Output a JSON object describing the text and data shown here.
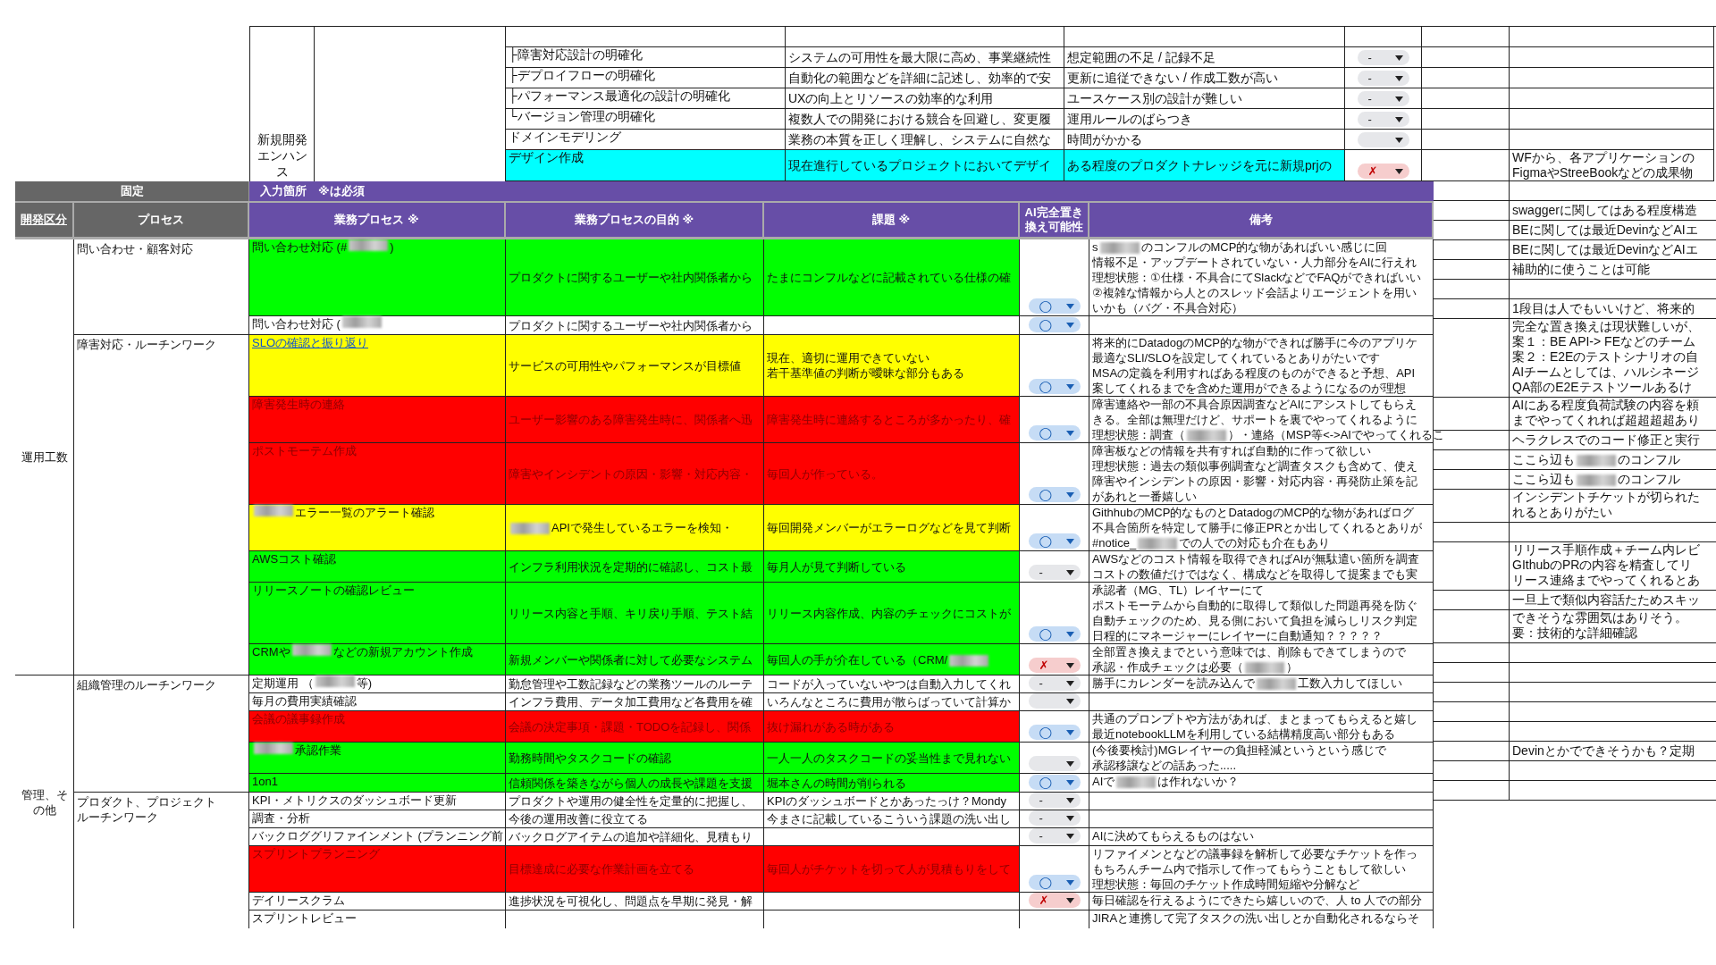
{
  "upper_section": {
    "category": "新規開発エンハンス",
    "rows": [
      {
        "process": "├障害対応設計の明確化",
        "purpose": "システムの可用性を最大限に高め、事業継続性",
        "issue": [
          "想定範囲の不足 / 記録不足"
        ],
        "ai": {
          "kind": "dash",
          "label": "-"
        },
        "color": "#ffffff"
      },
      {
        "process": "├デプロイフローの明確化",
        "purpose": "自動化の範囲などを詳細に記述し、効率的で安",
        "issue": [
          "更新に追従できない / 作成工数が高い"
        ],
        "ai": {
          "kind": "dash",
          "label": "-"
        },
        "color": "#ffffff"
      },
      {
        "process": "├パフォーマンス最適化の設計の明確化",
        "purpose": "UXの向上とリソースの効率的な利用",
        "issue": [
          "ユースケース別の設計が難しい"
        ],
        "ai": {
          "kind": "dash",
          "label": "-"
        },
        "color": "#ffffff"
      },
      {
        "process": "└バージョン管理の明確化",
        "purpose": "複数人での開発における競合を回避し、変更履",
        "issue": [
          "運用ルールのばらつき"
        ],
        "ai": {
          "kind": "dash",
          "label": "-"
        },
        "color": "#ffffff"
      },
      {
        "process": "ドメインモデリング",
        "purpose": "業務の本質を正しく理解し、システムに自然な",
        "issue": [
          "時間がかかる"
        ],
        "ai": {
          "kind": "empty"
        },
        "color": "#ffffff"
      },
      {
        "process": "デザイン作成",
        "purpose": "現在進行しているプロジェクトにおいてデザイ",
        "issue": [
          "ある程度のプロダクトナレッジを元に新規prjの"
        ],
        "ai": {
          "kind": "no",
          "label": "✗"
        },
        "color": "#00ffff",
        "note": [
          "WFから、各アプリケーションの",
          "FigmaやStreeBookなどの成果物"
        ]
      }
    ]
  },
  "header": {
    "fixed_label": "固定",
    "input_label": "入力箇所　※は必須",
    "columns": [
      "開発区分",
      "プロセス",
      "業務プロセス ※",
      "業務プロセスの目的 ※",
      "課題 ※",
      "AI完全置き換え可能性",
      "備考"
    ]
  },
  "sections": [
    {
      "label": "運用工数",
      "groups": [
        {
          "label": "問い合わせ・顧客対応",
          "rows": [
            {
              "process": [
                "問い合わせ対応 (#",
                {
                  "kind": "redaction"
                },
                ")"
              ],
              "link": false,
              "purpose": "プロダクトに関するユーザーや社内関係者から",
              "issue": [
                "たまにコンフルなどに記載されている仕様の確"
              ],
              "ai": {
                "kind": "yes",
                "label": "◯"
              },
              "color": "#00ff00",
              "note": [
                [
                  "s",
                  {
                    "kind": "redaction"
                  },
                  "のコンフルのMCP的な物があればいい感じに回"
                ],
                "情報不足・アップデートされていない・人力部分をAIに行えれ",
                "理想状態：①仕様・不具合にてSlackなどでFAQができればいい",
                "②複雑な情報から人とのスレッド会話よりエージェントを用い",
                "いかも（バグ・不具合対応）"
              ]
            },
            {
              "process": [
                "問い合わせ対応 (",
                {
                  "kind": "redaction"
                }
              ],
              "link": false,
              "purpose": "プロダクトに関するユーザーや社内関係者から",
              "ai": {
                "kind": "yes",
                "label": "◯"
              },
              "color": "#ffffff"
            }
          ]
        },
        {
          "label": "障害対応・ルーチンワーク",
          "rows": [
            {
              "process": "SLOの確認と振り返り",
              "link": true,
              "purpose": "サービスの可用性やパフォーマンスが目標値",
              "issue": [
                "現在、適切に運用できていない",
                "若干基準値の判断が曖昧な部分もある"
              ],
              "ai": {
                "kind": "yes",
                "label": "◯"
              },
              "color": "#ffff00",
              "note": [
                "将来的にDatadogのMCP的な物ができれば勝手に今のアプリケ",
                "最適なSLI/SLOを設定してくれているとありがたいです",
                "MSAの定義を利用すればある程度のものができると予想、API",
                "案してくれるまでを含めた運用ができるようになるのが理想"
              ]
            },
            {
              "process": "障害発生時の連絡",
              "link": false,
              "purpose": "ユーザー影響のある障害発生時に、関係者へ迅",
              "issue": [
                "障害発生時に連絡するところが多かったり、確"
              ],
              "ai": {
                "kind": "yes",
                "label": "◯"
              },
              "color": "#ff0000",
              "note": [
                "障害連絡や一部の不具合原因調査などAIにアシストしてもらえ",
                "きる。全部は無理だけど、サポートを裏でやってくれるように",
                [
                  "理想状態：調査（",
                  {
                    "kind": "redaction"
                  },
                  "）・連絡（MSP等<->AIでやってくれるこ"
                ]
              ]
            },
            {
              "process": "ポストモーテム作成",
              "link": false,
              "purpose": "障害やインシデントの原因・影響・対応内容・",
              "issue": [
                "毎回人が作っている。"
              ],
              "ai": {
                "kind": "yes",
                "label": "◯"
              },
              "color": "#ff0000",
              "note": [
                "障害板などの情報を共有すれば自動的に作って欲しい",
                "理想状態：過去の類似事例調査など調査タスクも含めて、使え",
                "障害やインシデントの原因・影響・対応内容・再発防止策を記",
                "があれと一番嬉しい"
              ]
            },
            {
              "process": [
                {
                  "kind": "redaction"
                },
                "エラー一覧のアラート確認"
              ],
              "link": false,
              "purpose": [
                {
                  "kind": "redaction"
                },
                "APIで発生しているエラーを検知・"
              ],
              "issue": [
                "毎回開発メンバーがエラーログなどを見て判断"
              ],
              "ai": {
                "kind": "yes",
                "label": "◯"
              },
              "color": "#ffff00",
              "note": [
                "GithhubのMCP的なものとDatadogのMCP的な物があればログ",
                "不具合箇所を特定して勝手に修正PRとか出してくれるとありが",
                [
                  "#notice_",
                  {
                    "kind": "redaction"
                  },
                  "での人での対応も介在もあり"
                ]
              ]
            },
            {
              "process": "AWSコスト確認",
              "link": false,
              "purpose": "インフラ利用状況を定期的に確認し、コスト最",
              "issue": [
                "毎月人が見て判断している"
              ],
              "ai": {
                "kind": "dash",
                "label": "-"
              },
              "color": "#00ff00",
              "note": [
                "AWSなどのコスト情報を取得できればAIが無駄遣い箇所を調査",
                "コストの数値だけではなく、構成などを取得して提案までも実"
              ]
            },
            {
              "process": "リリースノートの確認レビュー",
              "link": false,
              "purpose": "リリース内容と手順、キリ戻り手順、テスト結",
              "issue": [
                "リリース内容作成、内容のチェックにコストが"
              ],
              "ai": {
                "kind": "yes",
                "label": "◯"
              },
              "color": "#00ff00",
              "note": [
                "承認者（MG、TL）レイヤーにて",
                "ポストモーテムから自動的に取得して類似した問題再発を防ぐ",
                "自動チェックのため、見る側において負担を減らしリスク判定",
                "日程的にマネージャーにレイヤーに自動通知？？？？？"
              ]
            },
            {
              "process": [
                "CRMや",
                {
                  "kind": "redaction"
                },
                "などの新規アカウント作成"
              ],
              "link": false,
              "purpose": "新規メンバーや関係者に対して必要なシステム",
              "issue": [
                [
                  "毎回人の手が介在している（CRM/",
                  {
                    "kind": "redaction"
                  }
                ]
              ],
              "ai": {
                "kind": "no",
                "label": "✗"
              },
              "color": "#00ff00",
              "note": [
                "全部置き換えまでという意味では、削除もできてしまうので",
                [
                  "承認・作成チェックは必要（",
                  {
                    "kind": "redaction"
                  },
                  "）"
                ]
              ]
            }
          ]
        }
      ]
    },
    {
      "label": "管理、その他",
      "groups": [
        {
          "label": "組織管理のルーチンワーク",
          "rows": [
            {
              "process": [
                "定期運用 （",
                {
                  "kind": "redaction"
                },
                "等)"
              ],
              "link": false,
              "purpose": "勤怠管理や工数記録などの業務ツールのルーテ",
              "issue": [
                "コードが入っていないやつは自動入力してくれ"
              ],
              "ai": {
                "kind": "dash",
                "label": "-"
              },
              "color": "#ffffff",
              "note": [
                [
                  "勝手にカレンダーを読み込んで",
                  {
                    "kind": "redaction"
                  },
                  "工数入力してほしい"
                ]
              ]
            },
            {
              "process": "毎月の費用実績確認",
              "link": false,
              "purpose": "インフラ費用、データ加工費用など各費用を確",
              "issue": [
                "いろんなところに費用が散らばっていて計算か"
              ],
              "ai": {
                "kind": "empty"
              },
              "color": "#ffffff"
            },
            {
              "process": "会議の議事録作成",
              "link": false,
              "purpose": "会議の決定事項・課題・TODOを記録し、関係",
              "issue": [
                "抜け漏れがある時がある"
              ],
              "ai": {
                "kind": "yes",
                "label": "◯"
              },
              "color": "#ff0000",
              "note": [
                "共通のプロンプトや方法があれば、まとまってもらえると嬉し",
                "最近notebookLLMを利用している結構精度高い部分もある"
              ]
            },
            {
              "process": [
                {
                  "kind": "redaction"
                },
                "承認作業"
              ],
              "link": false,
              "purpose": "勤務時間やタスクコードの確認",
              "issue": [
                "一人一人のタスクコードの妥当性まで見れない"
              ],
              "ai": {
                "kind": "empty"
              },
              "color": "#00ff00",
              "note": [
                "(今後要検討)MGレイヤーの負担軽減というという感じで",
                "承認移譲などの話あった....."
              ]
            },
            {
              "process": "1on1",
              "link": false,
              "purpose": "信頼関係を築きながら個人の成長や課題を支援",
              "issue": [
                "堀本さんの時間が削られる"
              ],
              "ai": {
                "kind": "yes",
                "label": "◯"
              },
              "color": "#00ff00",
              "note": [
                [
                  "AIで",
                  {
                    "kind": "redaction"
                  },
                  "は作れないか？"
                ]
              ]
            }
          ]
        },
        {
          "label": "プロダクト、プロジェクトルーチンワーク",
          "rows": [
            {
              "process": "KPI・メトリクスのダッシュボード更新",
              "link": false,
              "purpose": "プロダクトや運用の健全性を定量的に把握し、",
              "issue": [
                "KPIのダッシュボードとかあったっけ？Mondy"
              ],
              "ai": {
                "kind": "dash",
                "label": "-"
              },
              "color": "#ffffff"
            },
            {
              "process": "調査・分析",
              "link": false,
              "purpose": "今後の運用改善に役立てる",
              "issue": [
                "今まさに記載しているこういう課題の洗い出し"
              ],
              "ai": {
                "kind": "dash",
                "label": "-"
              },
              "color": "#ffffff"
            },
            {
              "process": "バックロググリファインメント (プランニング前",
              "link": false,
              "purpose": "バックログアイテムの追加や詳細化、見積もり",
              "ai": {
                "kind": "dash",
                "label": "-"
              },
              "color": "#ffffff",
              "note": [
                "AIに決めてもらえるものはない"
              ]
            },
            {
              "process": "スプリントプランニング",
              "link": false,
              "purpose": "目標達成に必要な作業計画を立てる",
              "issue": [
                "毎回人がチケットを切って人が見積もりをして"
              ],
              "ai": {
                "kind": "yes",
                "label": "◯"
              },
              "color": "#ff0000",
              "note": [
                "リファイメンとなどの議事録を解析して必要なチケットを作っ",
                "もちろんチーム内で指示して作ってもらうこともして欲しい",
                "理想状態：毎回のチケット作成時間短縮や分解など"
              ]
            },
            {
              "process": "デイリースクラム",
              "link": false,
              "purpose": "進捗状況を可視化し、問題点を早期に発見・解",
              "ai": {
                "kind": "no",
                "label": "✗"
              },
              "color": "#ffffff",
              "note": [
                "毎日確認を行えるようにできたら嬉しいので、人 to 人での部分"
              ]
            },
            {
              "process": "スプリントレビュー",
              "link": false,
              "ai": {
                "kind": "empty_hidden"
              },
              "color": "#ffffff",
              "note": [
                "JIRAと連携して完了タスクの洗い出しとか自動化されるならそ"
              ]
            }
          ]
        }
      ]
    }
  ],
  "side_panel": {
    "rows": [
      {},
      {
        "note": [
          "swaggerに関してはある程度構造"
        ]
      },
      {
        "note": [
          "BEに関しては最近DevinなどAIエ"
        ]
      },
      {
        "note": [
          "BEに関しては最近DevinなどAIエ"
        ]
      },
      {
        "note": [
          "補助的に使うことは可能"
        ]
      },
      {},
      {
        "note": [
          "1段目は人でもいいけど、将来的"
        ]
      },
      {
        "note": [
          "完全な置き換えは現状難しいが、",
          "案１：BE API-> FEなどのチーム",
          "案２：E2Eのテストシナリオの自",
          "AIチームとしては、ハルシネージ",
          "QA部のE2Eテストツールあるけ"
        ]
      },
      {
        "note": [
          "AIにある程度負荷試験の内容を頼",
          "までやってくれれば超超超超あり"
        ]
      },
      {
        "note": [
          "ヘラクレスでのコード修正と実行"
        ]
      },
      {
        "note": [
          [
            "ここら辺も",
            {
              "kind": "redaction"
            },
            "のコンフル"
          ]
        ]
      },
      {
        "note": [
          [
            "ここら辺も",
            {
              "kind": "redaction"
            },
            "のコンフル"
          ]
        ]
      },
      {
        "note": [
          "インシデントチケットが切られた",
          "れるとありがたい"
        ]
      },
      {},
      {
        "note": [
          "リリース手順作成＋チーム内レビ",
          "GIthubのPRの内容を精査してリ",
          "リース連絡までやってくれるとあ"
        ]
      },
      {
        "note": [
          "一旦上で類似内容話たためスキッ"
        ]
      },
      {
        "note": [
          "できそうな雰囲気はありそう。",
          "要：技術的な詳細確認"
        ]
      },
      {},
      {},
      {},
      {},
      {},
      {
        "note": [
          "Devinとかでできそうかも？定期"
        ]
      },
      {},
      {}
    ]
  }
}
